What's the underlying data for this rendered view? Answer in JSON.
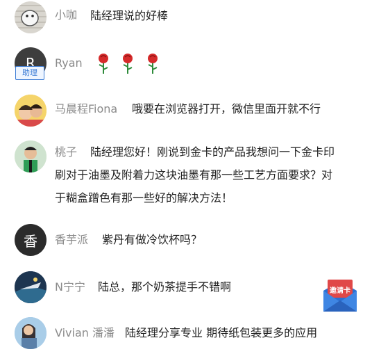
{
  "comments": [
    {
      "name": "小咖",
      "text": "陆经理说的好棒"
    },
    {
      "name": "Ryan",
      "avatar_letter": "R",
      "badge": "助理",
      "text": ""
    },
    {
      "name": "马晨程Fiona",
      "text": "哦要在浏览器打开，微信里面开就不行"
    },
    {
      "name": "桃子",
      "text_line1": "陆经理您好！刚说到金卡的产品我想问一下金卡印",
      "text_line2": "刷对于油墨及附着力这块油墨有那一些工艺方面要求？对",
      "text_line3": "于糊盒蹭色有那一些好的解决方法！"
    },
    {
      "name": "香芋派",
      "avatar_letter": "香",
      "text": "紫丹有做冷饮杯吗？"
    },
    {
      "name": "N宁宁",
      "text": "陆总，那个奶茶提手不错啊"
    },
    {
      "name": "Vivian 潘潘",
      "text": "陆经理分享专业 期待纸包装更多的应用"
    }
  ],
  "invite_card": {
    "label": "邀请卡"
  },
  "colors": {
    "accent_red": "#e04848",
    "badge_blue": "#3a7bd5",
    "invite_blue": "#2c6fd1"
  }
}
